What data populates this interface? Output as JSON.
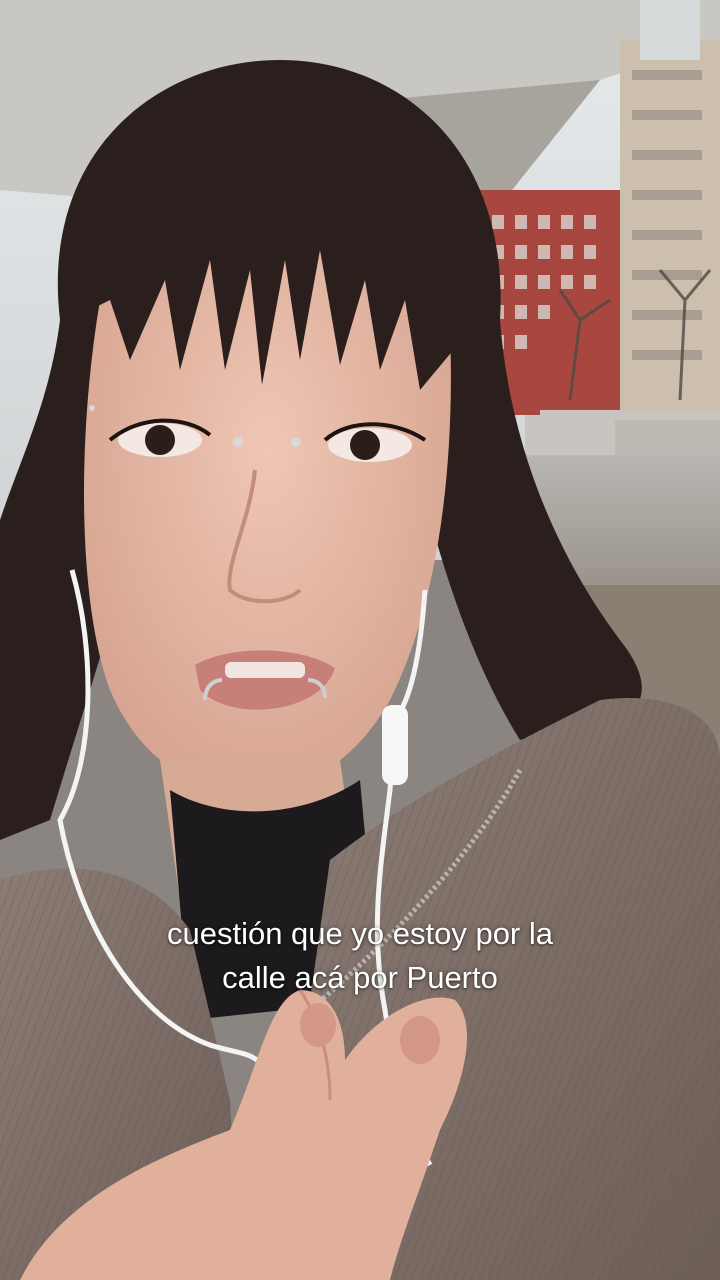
{
  "video": {
    "captions": [
      "cuestión que yo estoy por la",
      "calle acá por Puerto"
    ]
  },
  "colors": {
    "sky": "#dfe3e6",
    "brick_building": "#a8473f",
    "hair": "#2a1f1c",
    "skin": "#e2b6a3",
    "jacket": "#7d6e66",
    "earphone_cable": "#f4f4f4",
    "caption_text": "#ffffff"
  },
  "icons": {
    "earphones": "earphones-icon"
  }
}
